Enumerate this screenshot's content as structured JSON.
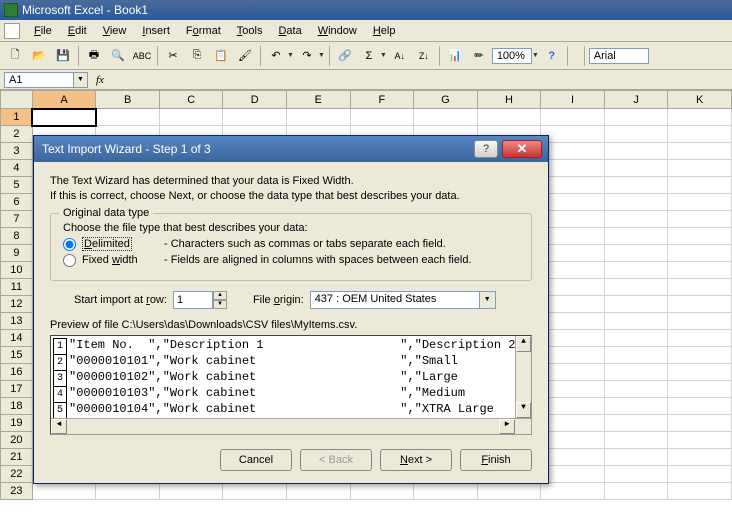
{
  "titlebar": {
    "text": "Microsoft Excel - Book1"
  },
  "menu": {
    "file": "File",
    "edit": "Edit",
    "view": "View",
    "insert": "Insert",
    "format": "Format",
    "tools": "Tools",
    "data": "Data",
    "window": "Window",
    "help": "Help"
  },
  "toolbar": {
    "zoom": "100%",
    "font": "Arial"
  },
  "namebox": {
    "value": "A1"
  },
  "columns": [
    "A",
    "B",
    "C",
    "D",
    "E",
    "F",
    "G",
    "H",
    "I",
    "J",
    "K"
  ],
  "rows": [
    "1",
    "2",
    "3",
    "4",
    "5",
    "6",
    "7",
    "8",
    "9",
    "10",
    "11",
    "12",
    "13",
    "14",
    "15",
    "16",
    "17",
    "18",
    "19",
    "20",
    "21",
    "22",
    "23"
  ],
  "dialog": {
    "title": "Text Import Wizard - Step 1 of 3",
    "intro1": "The Text Wizard has determined that your data is Fixed Width.",
    "intro2": "If this is correct, choose Next, or choose the data type that best describes your data.",
    "group_title": "Original data type",
    "choose_label": "Choose the file type that best describes your data:",
    "delimited_label": "Delimited",
    "delimited_desc": "- Characters such as commas or tabs separate each field.",
    "fixed_label": "Fixed width",
    "fixed_desc": "- Fields are aligned in columns with spaces between each field.",
    "start_row_label": "Start import at row:",
    "start_row_value": "1",
    "file_origin_label": "File origin:",
    "file_origin_value": "437 : OEM United States",
    "preview_label": "Preview of file C:\\Users\\das\\Downloads\\CSV files\\MyItems.csv.",
    "preview_lines": [
      "\"Item No.  \",\"Description 1                   \",\"Description 2",
      "\"0000010101\",\"Work cabinet                    \",\"Small",
      "\"0000010102\",\"Work cabinet                    \",\"Large",
      "\"0000010103\",\"Work cabinet                    \",\"Medium",
      "\"0000010104\",\"Work cabinet                    \",\"XTRA Large"
    ],
    "buttons": {
      "cancel": "Cancel",
      "back": "< Back",
      "next": "Next >",
      "finish": "Finish"
    }
  }
}
